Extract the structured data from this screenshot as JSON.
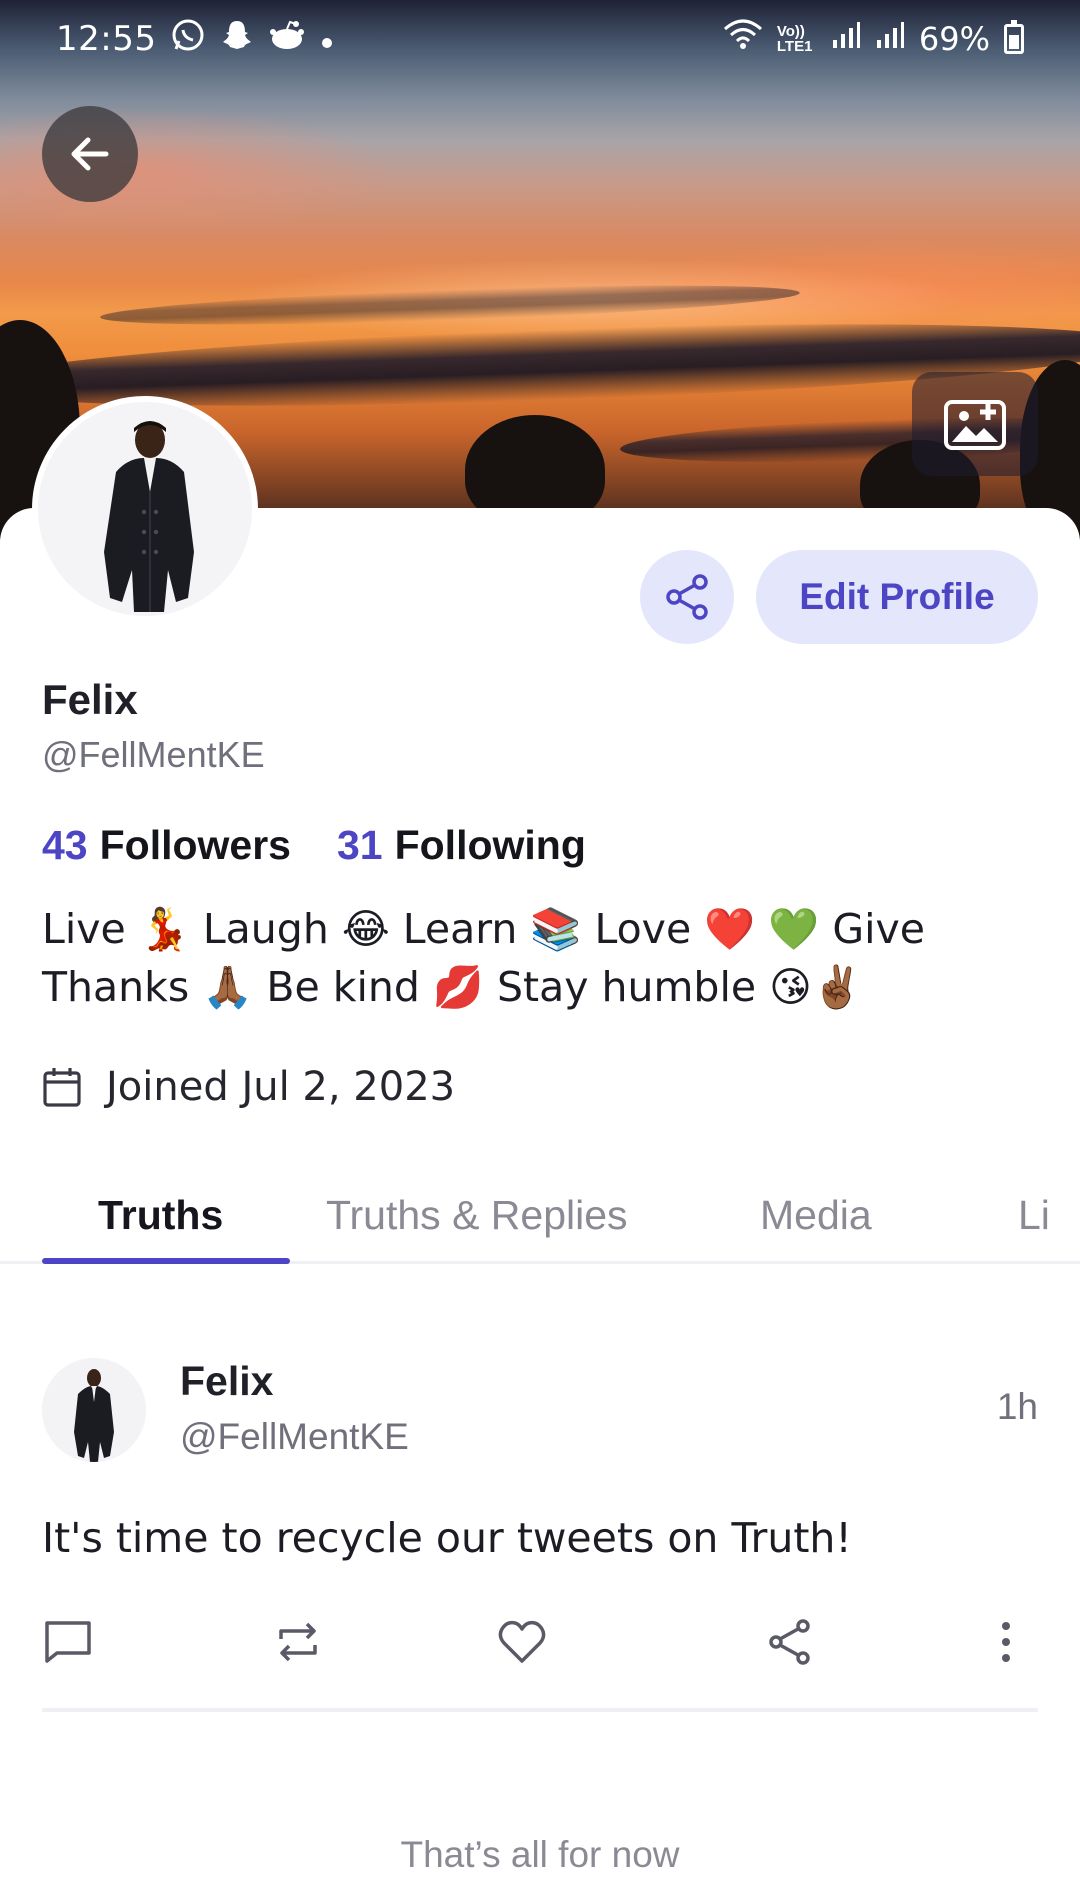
{
  "status_bar": {
    "time": "12:55",
    "left_icons": [
      "whatsapp-icon",
      "snapchat-icon",
      "reddit-icon",
      "dot-icon"
    ],
    "right_icons": [
      "wifi-icon",
      "volte-icon",
      "signal-icon",
      "signal-icon"
    ],
    "battery": "69%",
    "volte_text": "Vo)) LTE1"
  },
  "header": {
    "back_icon": "arrow-left-icon",
    "cover_photo_icon": "add-photo-icon"
  },
  "profile": {
    "name": "Felix",
    "handle": "@FellMentKE",
    "share_icon": "share-icon",
    "edit_button": "Edit Profile",
    "followers_count": "43",
    "followers_label": "Followers",
    "following_count": "31",
    "following_label": "Following",
    "bio": "Live 💃 Laugh 😂 Learn 📚 Love ❤️ 💚 Give Thanks 🙏🏾 Be kind 💋 Stay humble 😘✌🏾",
    "joined": "Joined Jul 2, 2023"
  },
  "tabs": [
    {
      "label": "Truths",
      "active": true
    },
    {
      "label": "Truths & Replies",
      "active": false
    },
    {
      "label": "Media",
      "active": false
    },
    {
      "label": "Li",
      "active": false
    }
  ],
  "post": {
    "name": "Felix",
    "handle": "@FellMentKE",
    "time": "1h",
    "text": "It's time to recycle our tweets on Truth!",
    "actions": [
      "reply-icon",
      "retruth-icon",
      "like-icon",
      "share-icon",
      "more-icon"
    ]
  },
  "feed_end": "That’s all for now",
  "colors": {
    "accent": "#4c46c4",
    "button_bg": "#e4e6fb"
  }
}
